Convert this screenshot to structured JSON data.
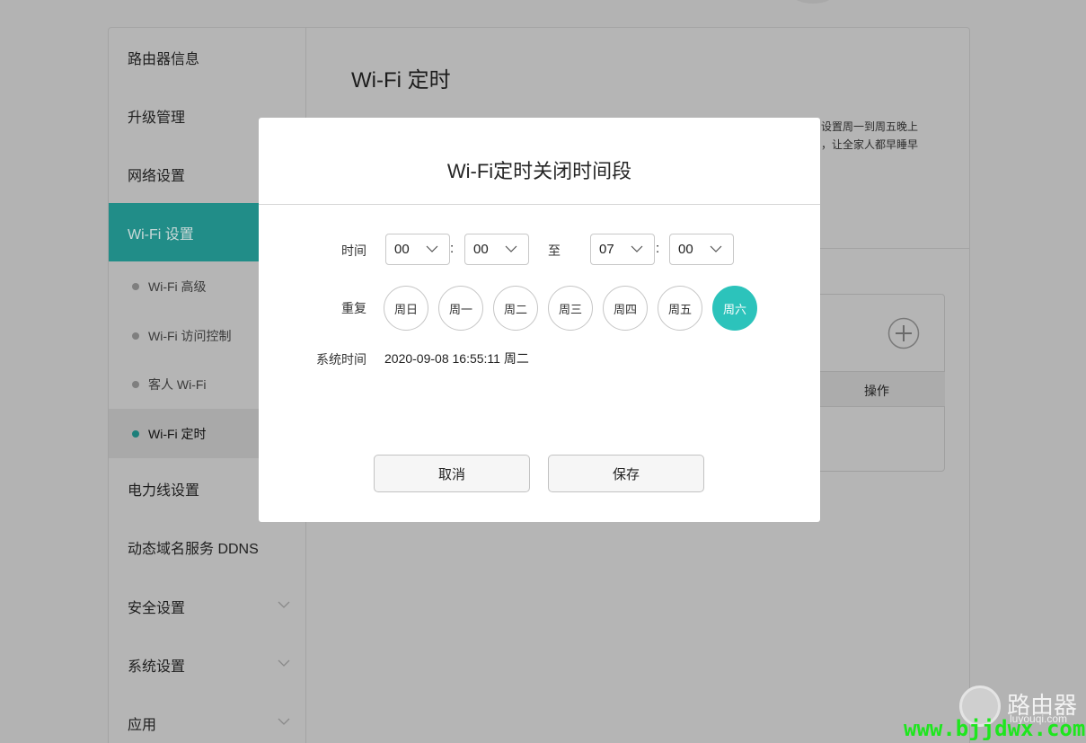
{
  "sidebar": {
    "items": [
      {
        "label": "路由器信息"
      },
      {
        "label": "升级管理"
      },
      {
        "label": "网络设置"
      },
      {
        "label": "Wi-Fi 设置"
      },
      {
        "label": "电力线设置"
      },
      {
        "label": "动态域名服务 DDNS"
      },
      {
        "label": "安全设置"
      },
      {
        "label": "系统设置"
      },
      {
        "label": "应用"
      }
    ],
    "wifi_sub": [
      {
        "label": "Wi-Fi 高级"
      },
      {
        "label": "Wi-Fi 访问控制"
      },
      {
        "label": "客人 Wi-Fi"
      },
      {
        "label": "Wi-Fi 定时"
      }
    ]
  },
  "content": {
    "title": "Wi-Fi 定时",
    "desc_line1": "设置周一到周五晚上",
    "desc_line2": "，让全家人都早睡早",
    "table_col_action": "操作"
  },
  "dialog": {
    "title": "Wi-Fi定时关闭时间段",
    "time_label": "时间",
    "start_hour": "00",
    "start_minute": "00",
    "colon": ":",
    "to_label": "至",
    "end_hour": "07",
    "end_minute": "00",
    "repeat_label": "重复",
    "days": [
      {
        "label": "周日",
        "selected": false
      },
      {
        "label": "周一",
        "selected": false
      },
      {
        "label": "周二",
        "selected": false
      },
      {
        "label": "周三",
        "selected": false
      },
      {
        "label": "周四",
        "selected": false
      },
      {
        "label": "周五",
        "selected": false
      },
      {
        "label": "周六",
        "selected": true
      }
    ],
    "system_time_label": "系统时间",
    "system_time_value": "2020-09-08 16:55:11 周二",
    "cancel_label": "取消",
    "save_label": "保存"
  },
  "watermark": {
    "brand": "路由器",
    "domain_small": "luyouqi.com",
    "url": "www.bjjdwx.com"
  },
  "colors": {
    "accent": "#2cc3bb",
    "sidebar_active": "#218d88",
    "watermark_url": "#1ee61e"
  }
}
